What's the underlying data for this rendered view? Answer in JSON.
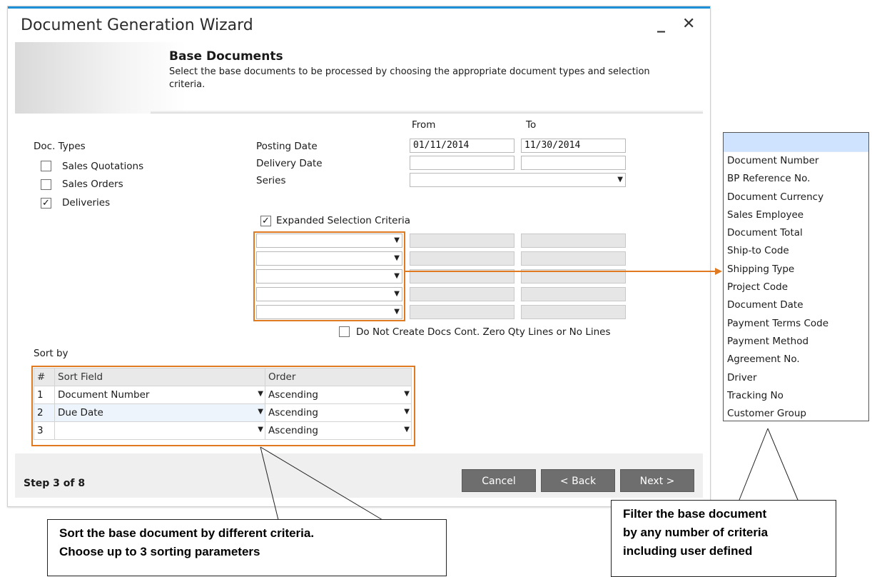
{
  "window": {
    "title": "Document Generation Wizard",
    "minimize": "_",
    "close": "✕"
  },
  "header": {
    "title": "Base Documents",
    "description": "Select the base documents to be processed by choosing the appropriate document types and selection criteria."
  },
  "doc_types": {
    "label": "Doc. Types",
    "items": [
      {
        "label": "Sales Quotations",
        "checked": false
      },
      {
        "label": "Sales Orders",
        "checked": false
      },
      {
        "label": "Deliveries",
        "checked": true
      }
    ]
  },
  "criteria": {
    "from_label": "From",
    "to_label": "To",
    "posting_date_label": "Posting Date",
    "posting_from": "01/11/2014",
    "posting_to": "11/30/2014",
    "delivery_date_label": "Delivery Date",
    "delivery_from": "",
    "delivery_to": "",
    "series_label": "Series",
    "series_value": "",
    "expanded_label": "Expanded Selection Criteria",
    "expanded_checked": true,
    "zero_qty_label": "Do Not Create Docs Cont. Zero Qty Lines or No Lines",
    "zero_qty_checked": false
  },
  "sort": {
    "label": "Sort by",
    "headers": [
      "#",
      "Sort Field",
      "Order"
    ],
    "rows": [
      {
        "num": "1",
        "field": "Document Number",
        "order": "Ascending"
      },
      {
        "num": "2",
        "field": "Due Date",
        "order": "Ascending"
      },
      {
        "num": "3",
        "field": "",
        "order": "Ascending"
      }
    ]
  },
  "footer": {
    "step": "Step 3 of 8",
    "cancel": "Cancel",
    "back": "< Back",
    "next": "Next >"
  },
  "dropdown_list": {
    "items": [
      "Document Number",
      "BP Reference No.",
      "Document Currency",
      "Sales Employee",
      "Document Total",
      "Ship-to Code",
      "Shipping Type",
      "Project Code",
      "Document Date",
      "Payment Terms Code",
      "Payment Method",
      "Agreement No.",
      "Driver",
      "Tracking No",
      "Customer Group"
    ]
  },
  "callouts": {
    "sort_line1": "Sort the base document by different criteria.",
    "sort_line2": "Choose up to 3 sorting parameters",
    "filter_line1": "Filter the base document",
    "filter_line2": "by any number of criteria",
    "filter_line3": "including user defined"
  },
  "colors": {
    "accent": "#e07a20",
    "title_bar": "#1e90d8",
    "button": "#6e6e6e"
  }
}
